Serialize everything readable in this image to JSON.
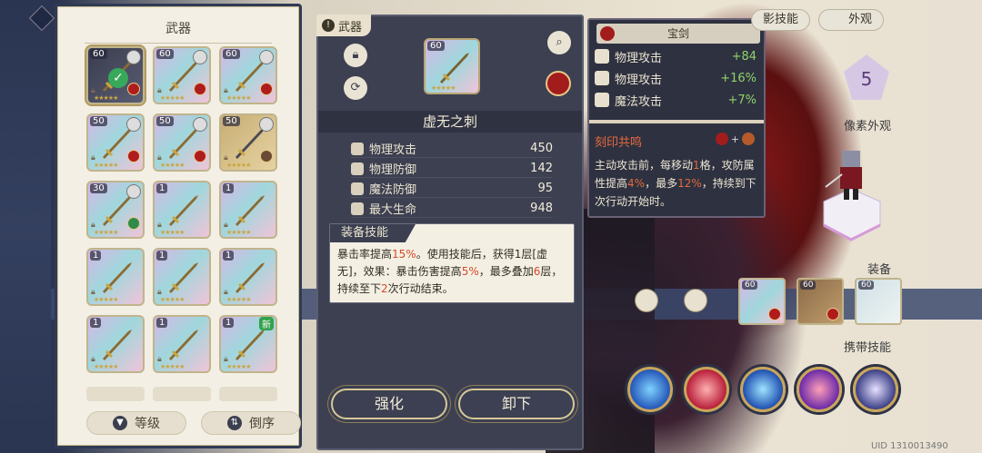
{
  "left_panel": {
    "title": "武器",
    "items": [
      {
        "level": "60",
        "selected": true,
        "style": "dark",
        "badge": "red"
      },
      {
        "level": "60",
        "style": "pastel",
        "badge": "red"
      },
      {
        "level": "60",
        "style": "pastel",
        "badge": "red"
      },
      {
        "level": "50",
        "style": "pastel",
        "badge": "red"
      },
      {
        "level": "50",
        "style": "pastel",
        "badge": "red"
      },
      {
        "level": "50",
        "style": "gold",
        "badge": "brown"
      },
      {
        "level": "30",
        "style": "pastel",
        "badge": "green"
      },
      {
        "level": "1",
        "style": "pastel"
      },
      {
        "level": "1",
        "style": "pastel"
      },
      {
        "level": "1",
        "style": "pastel"
      },
      {
        "level": "1",
        "style": "pastel"
      },
      {
        "level": "1",
        "style": "pastel"
      },
      {
        "level": "1",
        "style": "pastel"
      },
      {
        "level": "1",
        "style": "pastel"
      },
      {
        "level": "1",
        "style": "pastel",
        "new_tag": "新"
      }
    ],
    "sort_level_label": "等级",
    "sort_order_label": "倒序"
  },
  "detail": {
    "tab_label": "武器",
    "level": "60",
    "name": "虚无之刺",
    "stats": [
      {
        "label": "物理攻击",
        "value": "450"
      },
      {
        "label": "物理防御",
        "value": "142"
      },
      {
        "label": "魔法防御",
        "value": "95"
      },
      {
        "label": "最大生命",
        "value": "948"
      }
    ],
    "skill_header": "装备技能",
    "skill_text_parts": [
      "暴击率提高",
      "15%",
      "。使用技能后，获得1层[虚无]，效果：暴击伤害提高",
      "5%",
      "，最多叠加",
      "6",
      "层，持续至下",
      "2",
      "次行动结束。"
    ],
    "upgrade_button": "强化",
    "unequip_button": "卸下"
  },
  "tooltip": {
    "header": "宝剑",
    "bonuses": [
      {
        "label": "物理攻击",
        "value": "+84"
      },
      {
        "label": "物理攻击",
        "value": "+16%"
      },
      {
        "label": "魔法攻击",
        "value": "+7%"
      }
    ],
    "engrave_title": "刻印共鸣",
    "engrave_plus": "+",
    "engrave_text_parts": [
      "主动攻击前，每移动",
      "1",
      "格，攻防属性提高",
      "4%",
      "，最多",
      "12%",
      "，持续到下次行动开始时。"
    ]
  },
  "right": {
    "skills_tab": "影技能",
    "appearance_tab": "外观",
    "pentagon_value": "5",
    "pixel_label": "像素外观",
    "equip_label": "装备",
    "equip_items": [
      {
        "level": "60"
      },
      {
        "level": "60"
      },
      {
        "level": "60"
      }
    ],
    "carry_skills_label": "携带技能",
    "uid": "UID 1310013490"
  },
  "colors": {
    "panel_dark": "#3d4050",
    "accent_gold": "#c9a65a",
    "highlight_red": "#d64a2a",
    "bonus_green": "#8ed46a"
  }
}
